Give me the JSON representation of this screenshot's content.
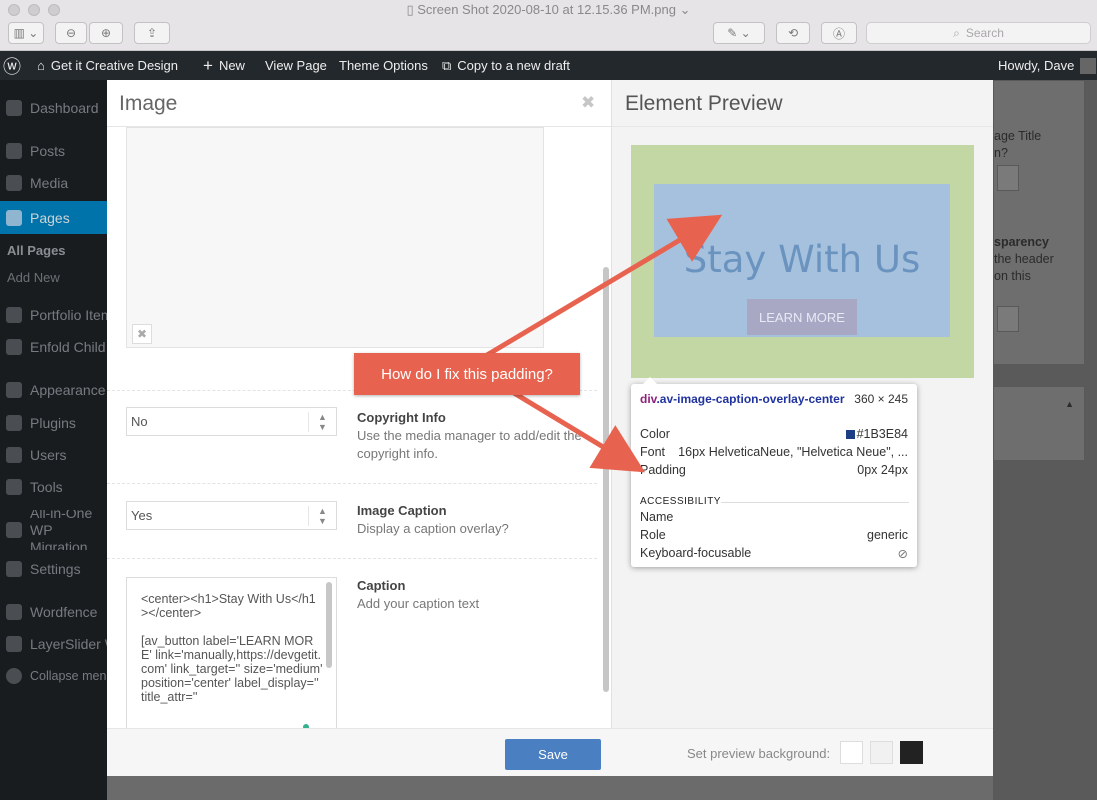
{
  "window": {
    "title": "Screen Shot 2020-08-10 at 12.15.36 PM.png",
    "search_placeholder": "Search"
  },
  "adminbar": {
    "site_name": "Get it Creative Design",
    "new_label": "New",
    "view_page": "View Page",
    "theme_options": "Theme Options",
    "copy_draft": "Copy to a new draft",
    "howdy": "Howdy, Dave"
  },
  "sidebar": {
    "items": [
      {
        "label": "Dashboard"
      },
      {
        "label": "Posts"
      },
      {
        "label": "Media"
      },
      {
        "label": "Pages"
      },
      {
        "label": "Portfolio Items"
      },
      {
        "label": "Enfold Child"
      },
      {
        "label": "Appearance"
      },
      {
        "label": "Plugins"
      },
      {
        "label": "Users"
      },
      {
        "label": "Tools"
      },
      {
        "label": "All-in-One WP Migration"
      },
      {
        "label": "Settings"
      },
      {
        "label": "Wordfence"
      },
      {
        "label": "LayerSlider WP"
      },
      {
        "label": "Collapse menu"
      }
    ],
    "sub_items": [
      {
        "label": "All Pages"
      },
      {
        "label": "Add New"
      }
    ]
  },
  "background_page": {
    "text1": "age Title\nn?",
    "text2_bold": "sparency",
    "text2": "the header\non this"
  },
  "modal": {
    "title": "Image",
    "close": "✖",
    "copyright": {
      "value": "No",
      "label": "Copyright Info",
      "desc": "Use the media manager to add/edit the copyright info."
    },
    "image_caption": {
      "value": "Yes",
      "label": "Image Caption",
      "desc": "Display a caption overlay?"
    },
    "caption": {
      "label": "Caption",
      "desc": "Add your caption text",
      "text": "<center><h1>Stay With Us</h1></center>\n\n[av_button label='LEARN MORE' link='manually,https://devgetit.com' link_target='' size='medium' position='center' label_display='' title_attr=''"
    },
    "save_label": "Save"
  },
  "preview": {
    "title": "Element Preview",
    "heading": "Stay With Us",
    "button": "LEARN MORE",
    "background_label": "Set preview background:",
    "swatches": [
      "#ffffff",
      "#f1f1f1",
      "#222222"
    ]
  },
  "inspector": {
    "tag": "div",
    "selector": ".av-image-caption-overlay-center",
    "size": "360 × 245",
    "color_label": "Color",
    "color_value": "#1B3E84",
    "font_label": "Font",
    "font_value": "16px HelveticaNeue, \"Helvetica Neue\", ...",
    "padding_label": "Padding",
    "padding_value": "0px 24px",
    "accessibility_heading": "ACCESSIBILITY",
    "name_label": "Name",
    "name_value": "",
    "role_label": "Role",
    "role_value": "generic",
    "focus_label": "Keyboard-focusable",
    "focus_value": "⃠"
  },
  "annotation": {
    "text": "How do I fix this padding?",
    "color": "#e8634f"
  }
}
